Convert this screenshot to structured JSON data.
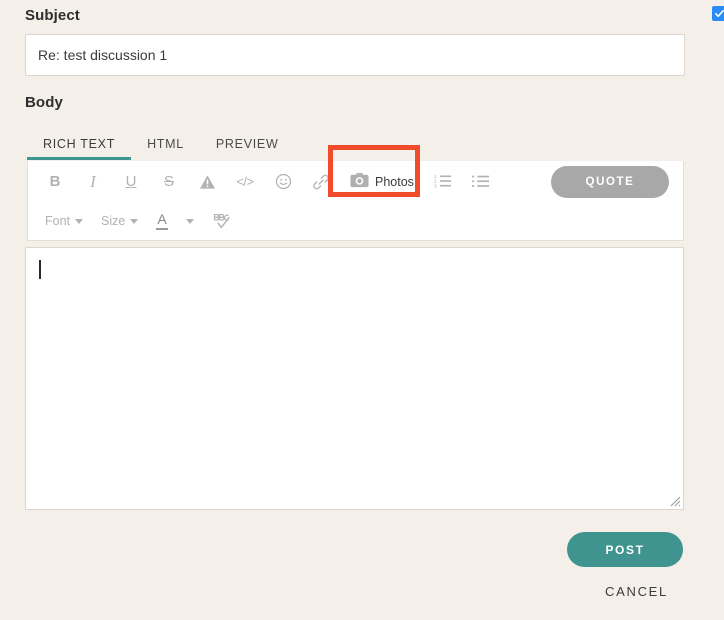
{
  "colors": {
    "page_background": "#f4efe9",
    "accent_teal": "#3f9490",
    "highlight_red": "#f04b2a",
    "quote_gray": "#a8a8a8",
    "checkbox_blue": "#2a8cf5"
  },
  "corner": {
    "checkbox_icon": "checkmark-icon",
    "checked": true
  },
  "subject": {
    "label": "Subject",
    "value": "Re: test discussion 1",
    "placeholder": "Subject"
  },
  "body": {
    "label": "Body",
    "value": "",
    "placeholder": ""
  },
  "tabs": [
    {
      "label": "RICH TEXT",
      "active": true
    },
    {
      "label": "HTML",
      "active": false
    },
    {
      "label": "PREVIEW",
      "active": false
    }
  ],
  "toolbar": {
    "row1": [
      {
        "name": "bold-icon",
        "glyph": "B"
      },
      {
        "name": "italic-icon",
        "glyph": "I"
      },
      {
        "name": "underline-icon",
        "glyph": "U"
      },
      {
        "name": "strikethrough-icon",
        "glyph": "S"
      },
      {
        "name": "warning-triangle-icon",
        "glyph": ""
      },
      {
        "name": "code-icon",
        "glyph": "</>"
      },
      {
        "name": "emoji-icon",
        "glyph": ""
      },
      {
        "name": "link-icon",
        "glyph": ""
      },
      {
        "name": "ordered-list-icon",
        "glyph": ""
      },
      {
        "name": "unordered-list-icon",
        "glyph": ""
      }
    ],
    "photos_button": {
      "label": "Photos",
      "icon": "camera-icon",
      "highlighted": true
    },
    "quote_button": {
      "label": "QUOTE"
    },
    "row2": {
      "font_label": "Font",
      "size_label": "Size",
      "text_color_glyph": "A",
      "spellcheck_icon": "spellcheck-abc-icon"
    }
  },
  "actions": {
    "post_label": "POST",
    "cancel_label": "CANCEL"
  }
}
